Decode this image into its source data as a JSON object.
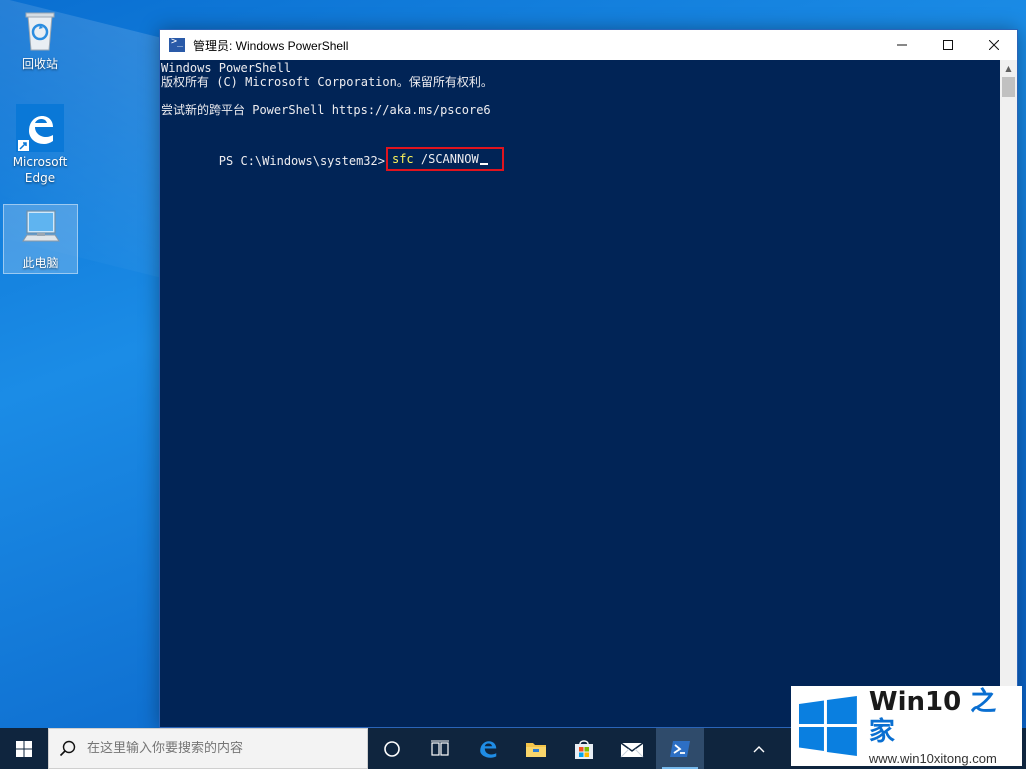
{
  "desktop": {
    "icons": [
      {
        "label": "回收站"
      },
      {
        "label": "Microsoft Edge"
      },
      {
        "label": "此电脑"
      }
    ]
  },
  "window": {
    "title": "管理员: Windows PowerShell",
    "controls": {
      "minimize": "—",
      "maximize": "☐",
      "close": "✕"
    },
    "console": {
      "lines": [
        "Windows PowerShell",
        "版权所有 (C) Microsoft Corporation。保留所有权利。",
        "",
        "尝试新的跨平台 PowerShell https://aka.ms/pscore6",
        ""
      ],
      "prompt": "PS C:\\Windows\\system32>",
      "command_name": "sfc",
      "command_args": " /SCANNOW"
    },
    "colors": {
      "console_bg": "#012456",
      "highlight": "#e0141e",
      "command": "#fdf35a"
    }
  },
  "taskbar": {
    "search_placeholder": "在这里输入你要搜索的内容",
    "items": [
      "start-icon",
      "cortana-icon",
      "task-view-icon",
      "edge-icon",
      "file-explorer-icon",
      "store-icon",
      "mail-icon",
      "powershell-icon"
    ]
  },
  "watermark": {
    "title_a": "Win10",
    "title_b": " 之家",
    "url": "www.win10xitong.com"
  }
}
